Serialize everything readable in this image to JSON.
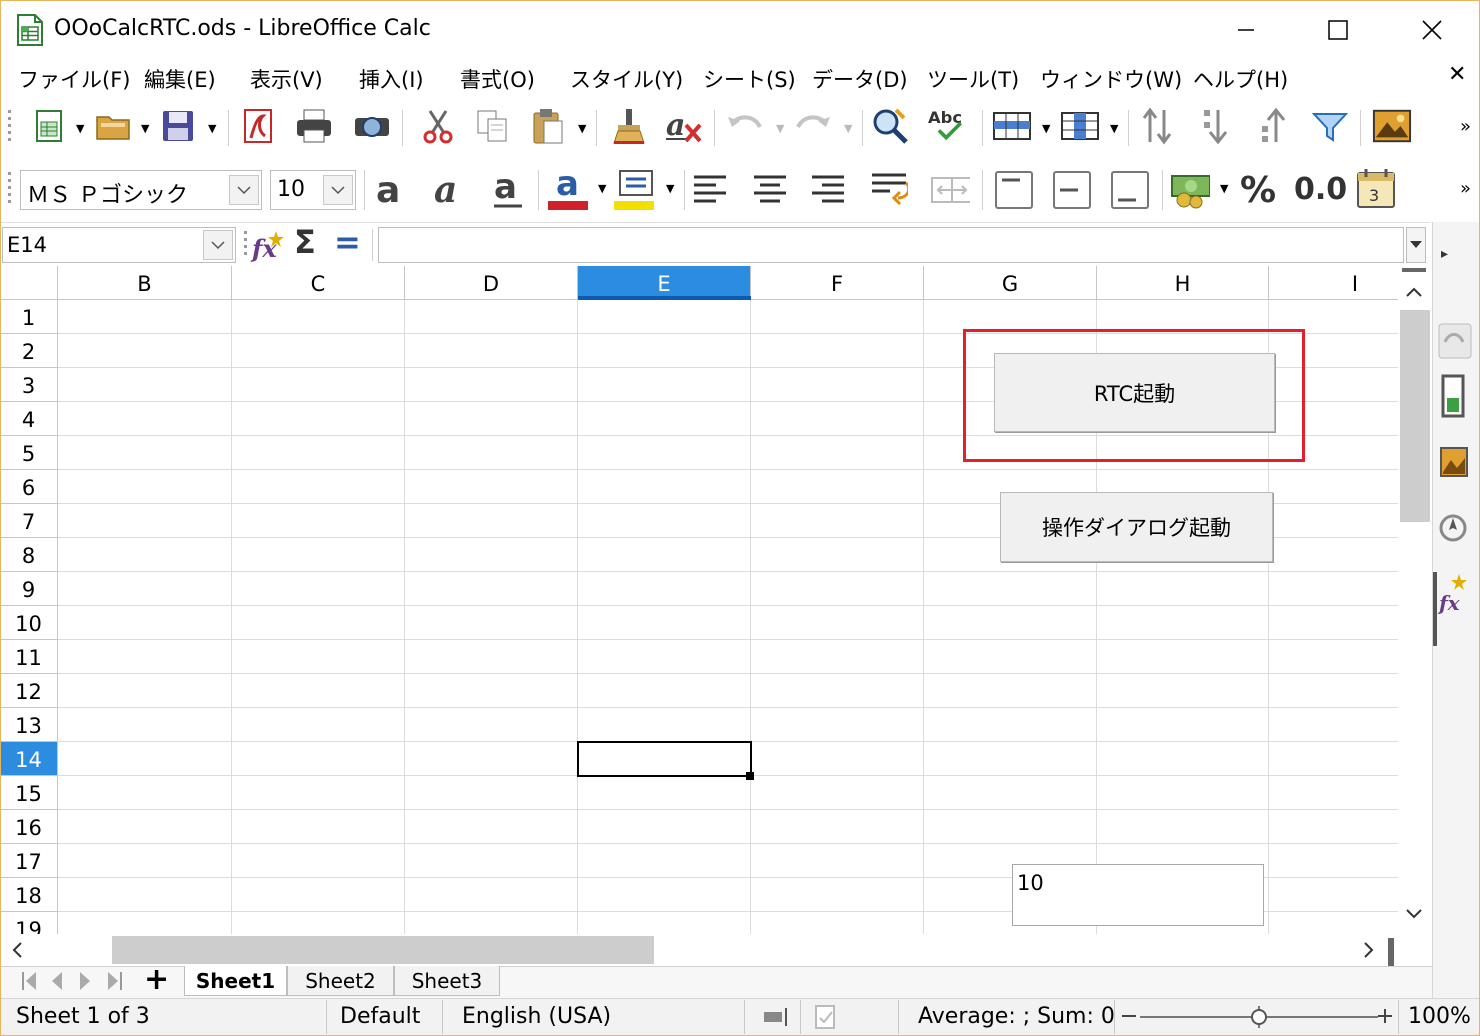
{
  "window": {
    "title": "OOoCalcRTC.ods - LibreOffice Calc",
    "minimize_glyph": "—",
    "maximize_glyph": "☐",
    "close_glyph": "✕"
  },
  "menubar": {
    "items": [
      "ファイル(F)",
      "編集(E)",
      "表示(V)",
      "挿入(I)",
      "書式(O)",
      "スタイル(Y)",
      "シート(S)",
      "データ(D)",
      "ツール(T)",
      "ウィンドウ(W)",
      "ヘルプ(H)"
    ],
    "close_glyph": "✕"
  },
  "toolbar_format": {
    "font_name": "ＭＳ Ｐゴシック",
    "font_size": "10",
    "percent_label": "%",
    "number_label": "0.0",
    "more_glyph": "»"
  },
  "toolbar_standard": {
    "spell_label": "Abc",
    "more_glyph": "»"
  },
  "formula_bar": {
    "name_box": "E14",
    "formula": "",
    "sum_glyph": "Σ",
    "equals_glyph": "="
  },
  "grid": {
    "columns": [
      "B",
      "C",
      "D",
      "E",
      "F",
      "G",
      "H",
      "I"
    ],
    "selected_column": "E",
    "rows": [
      "1",
      "2",
      "3",
      "4",
      "5",
      "6",
      "7",
      "8",
      "9",
      "10",
      "11",
      "12",
      "13",
      "14",
      "15",
      "16",
      "17",
      "18",
      "19"
    ],
    "selected_row": "14",
    "active_cell": "E14"
  },
  "form_controls": {
    "rtc_button": "RTC起動",
    "dialog_button": "操作ダイアログ起動",
    "text_box_value": "10"
  },
  "sheet_tabs": {
    "add_glyph": "+",
    "tabs": [
      "Sheet1",
      "Sheet2",
      "Sheet3"
    ],
    "active": "Sheet1"
  },
  "status_bar": {
    "sheet_info": "Sheet 1 of 3",
    "page_style": "Default",
    "language": "English (USA)",
    "summary": "Average: ; Sum: 0",
    "zoom": "100%",
    "zoom_level": 0.5
  },
  "colors": {
    "accent_selection": "#2c8de0",
    "highlight_box": "#e0202a",
    "window_border": "#e8b65a"
  }
}
